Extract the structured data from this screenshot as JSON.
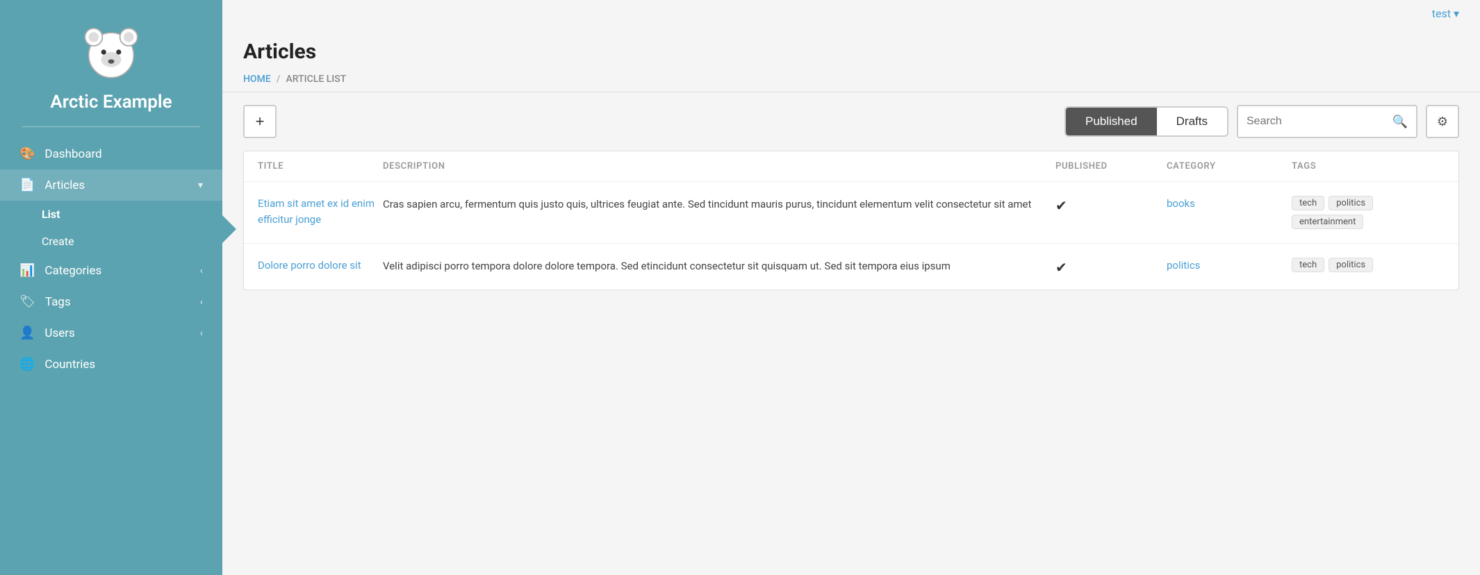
{
  "app": {
    "name": "Arctic Example",
    "logo_alt": "polar bear logo"
  },
  "topbar": {
    "user_label": "test",
    "user_chevron": "▾"
  },
  "breadcrumb": {
    "home": "HOME",
    "separator": "/",
    "current": "ARTICLE LIST"
  },
  "page": {
    "title": "Articles"
  },
  "toolbar": {
    "add_label": "+",
    "tab_published": "Published",
    "tab_drafts": "Drafts",
    "search_placeholder": "Search"
  },
  "table": {
    "columns": [
      "TITLE",
      "DESCRIPTION",
      "PUBLISHED",
      "CATEGORY",
      "TAGS"
    ],
    "rows": [
      {
        "title": "Etiam sit amet ex id enim efficitur jonge",
        "description": "Cras sapien arcu, fermentum quis justo quis, ultrices feugiat ante. Sed tincidunt mauris purus, tincidunt elementum velit consectetur sit amet",
        "published": true,
        "category": "books",
        "tags": [
          "tech",
          "politics",
          "entertainment"
        ]
      },
      {
        "title": "Dolore porro dolore sit",
        "description": "Velit adipisci porro tempora dolore dolore tempora. Sed etincidunt consectetur sit quisquam ut. Sed sit tempora eius ipsum",
        "published": true,
        "category": "politics",
        "tags": [
          "tech",
          "politics"
        ]
      }
    ]
  },
  "sidebar": {
    "nav_items": [
      {
        "id": "dashboard",
        "label": "Dashboard",
        "icon": "🎨",
        "has_chevron": false
      },
      {
        "id": "articles",
        "label": "Articles",
        "icon": "📄",
        "has_chevron": true
      },
      {
        "id": "categories",
        "label": "Categories",
        "icon": "📊",
        "has_chevron": true
      },
      {
        "id": "tags",
        "label": "Tags",
        "icon": "🏷",
        "has_chevron": true
      },
      {
        "id": "users",
        "label": "Users",
        "icon": "👤",
        "has_chevron": true
      },
      {
        "id": "countries",
        "label": "Countries",
        "icon": "🌐",
        "has_chevron": false
      }
    ],
    "sub_nav": [
      {
        "id": "list",
        "label": "List"
      },
      {
        "id": "create",
        "label": "Create"
      }
    ]
  }
}
